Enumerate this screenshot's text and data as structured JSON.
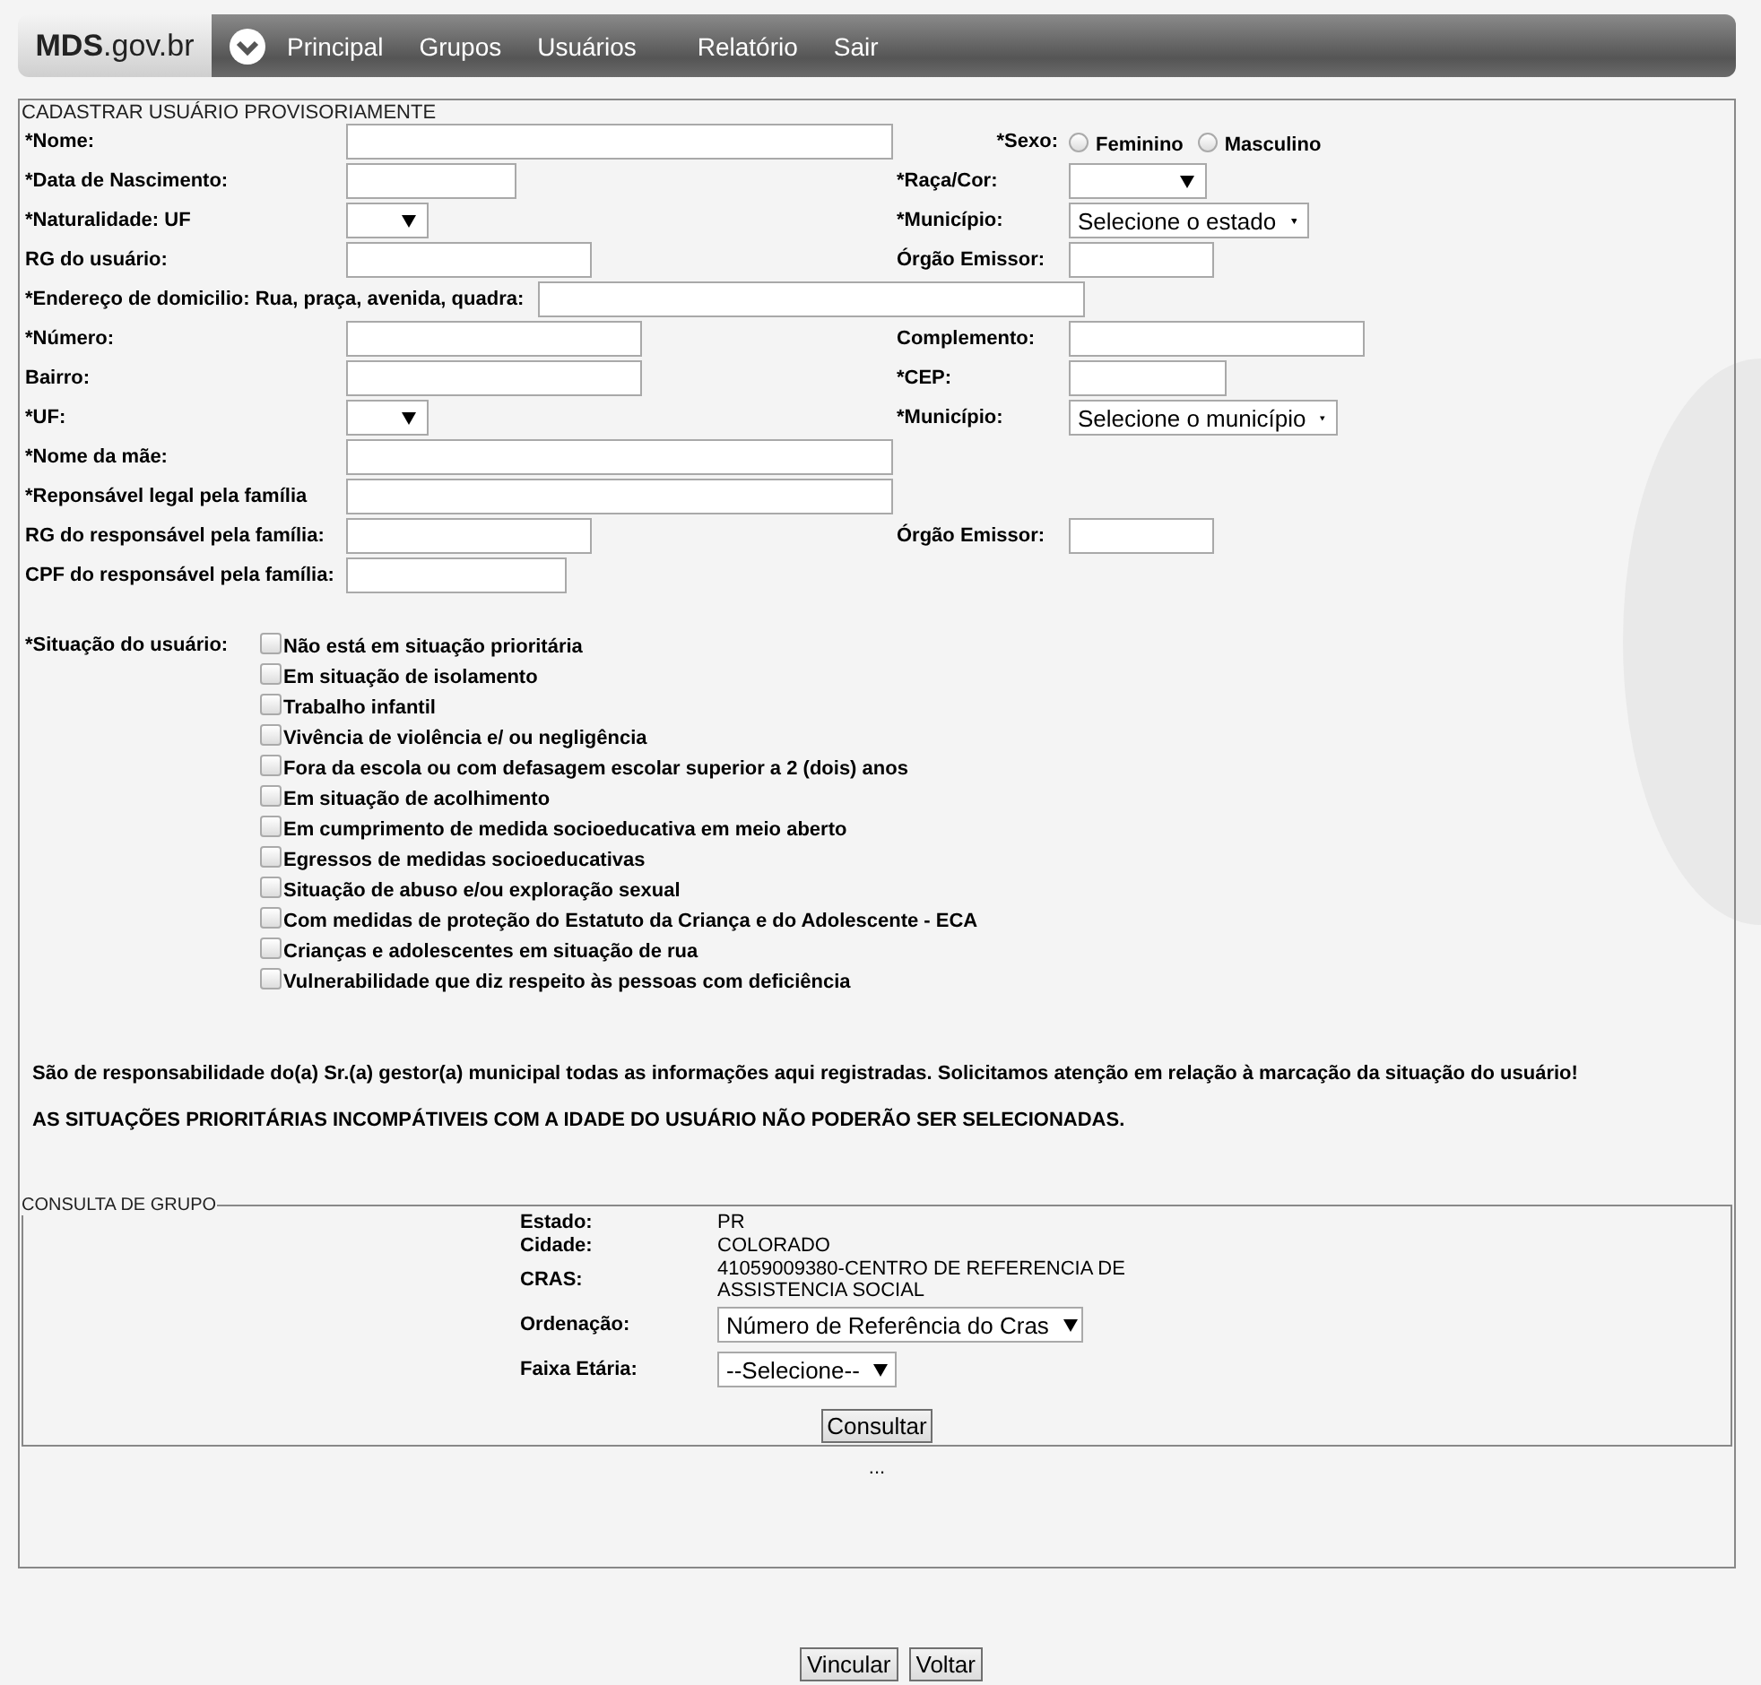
{
  "nav": {
    "logo": "**MDS**.gov.br",
    "items": [
      {
        "label": "Principal"
      },
      {
        "label": "Grupos"
      },
      {
        "label": "Usuários"
      },
      {
        "label": "Relatório"
      },
      {
        "label": "Sair"
      }
    ]
  },
  "form": {
    "title": "CADASTRAR USUÁRIO PROVISORIAMENTE",
    "rows": [
      {
        "left": {
          "label": "*Nome:",
          "kind": "text"
        },
        "right": {
          "label": "*Sexo:",
          "kind": "radio",
          "options": [
            {
              "label": "Feminino",
              "selected": false
            },
            {
              "label": "Masculino",
              "selected": false
            }
          ]
        }
      },
      {
        "left": {
          "label": "*Data de Nascimento:",
          "kind": "text"
        },
        "right": {
          "label": "*Raça/Cor:",
          "kind": "select"
        }
      },
      {
        "left": {
          "label": "*Naturalidade: UF",
          "kind": "select"
        },
        "right": {
          "label": "*Município:",
          "kind": "select",
          "value": "Selecione o estado"
        }
      },
      {
        "left": {
          "label": "RG do usuário:",
          "kind": "text"
        },
        "right": {
          "label": "Órgão Emissor:",
          "kind": "text"
        }
      },
      {
        "full": {
          "label": "*Endereço de domicilio: Rua, praça, avenida, quadra:",
          "kind": "text"
        }
      },
      {
        "left": {
          "label": "*Número:",
          "kind": "text"
        },
        "right": {
          "label": "Complemento:",
          "kind": "text"
        }
      },
      {
        "left": {
          "label": "Bairro:",
          "kind": "text"
        },
        "right": {
          "label": "*CEP:",
          "kind": "text"
        }
      },
      {
        "left": {
          "label": "*UF:",
          "kind": "select"
        },
        "right": {
          "label": "*Município:",
          "kind": "select",
          "value": "Selecione o município"
        }
      },
      {
        "left": {
          "label": "*Nome da mãe:",
          "kind": "text"
        }
      },
      {
        "left": {
          "label": "*Reponsável legal pela família",
          "kind": "text"
        }
      },
      {
        "left": {
          "label": "RG do responsável pela família:",
          "kind": "text"
        },
        "right": {
          "label": "Órgão Emissor:",
          "kind": "text"
        }
      },
      {
        "left": {
          "label": "CPF do responsável pela família:",
          "kind": "text"
        }
      }
    ],
    "situation": {
      "label": "*Situação do usuário:",
      "options": [
        {
          "label": "Não está em situação prioritária",
          "checked": false
        },
        {
          "label": "Em situação de isolamento",
          "checked": false
        },
        {
          "label": "Trabalho infantil",
          "checked": false
        },
        {
          "label": "Vivência de violência e/ ou negligência",
          "checked": false
        },
        {
          "label": "Fora da escola ou com defasagem escolar superior a 2 (dois) anos",
          "checked": false
        },
        {
          "label": "Em situação de acolhimento",
          "checked": false
        },
        {
          "label": "Em cumprimento de medida socioeducativa em meio aberto",
          "checked": false
        },
        {
          "label": "Egressos de medidas socioeducativas",
          "checked": false
        },
        {
          "label": "Situação de abuso e/ou exploração sexual",
          "checked": false
        },
        {
          "label": "Com medidas de proteção do Estatuto da Criança e do Adolescente - ECA",
          "checked": false
        },
        {
          "label": "Crianças e adolescentes em situação de rua",
          "checked": false
        },
        {
          "label": "Vulnerabilidade que diz respeito às pessoas com deficiência",
          "checked": false
        }
      ]
    },
    "notices": [
      "São de responsabilidade do(a) Sr.(a) gestor(a) municipal todas as informações aqui registradas. Solicitamos atenção em relação à marcação da situação do usuário!",
      "AS SITUAÇÕES PRIORITÁRIAS INCOMPÁTIVEIS COM A IDADE DO USUÁRIO NÃO PODERÃO SER SELECIONADAS."
    ]
  },
  "group": {
    "legend": "CONSULTA DE GRUPO",
    "fields": [
      {
        "label": "Estado:",
        "kind": "info",
        "value": "PR"
      },
      {
        "label": "Cidade:",
        "kind": "info",
        "value": "COLORADO"
      },
      {
        "label": "CRAS:",
        "kind": "info",
        "value": "41059009380-CENTRO DE REFERENCIA DE ASSISTENCIA SOCIAL"
      },
      {
        "label": "Ordenação:",
        "kind": "select",
        "value": "Número de Referência do Cras"
      },
      {
        "label": "Faixa Etária:",
        "kind": "select",
        "value": "--Selecione--"
      }
    ],
    "button": "Consultar",
    "results": "..."
  },
  "actions": [
    "Vincular",
    "Voltar"
  ]
}
